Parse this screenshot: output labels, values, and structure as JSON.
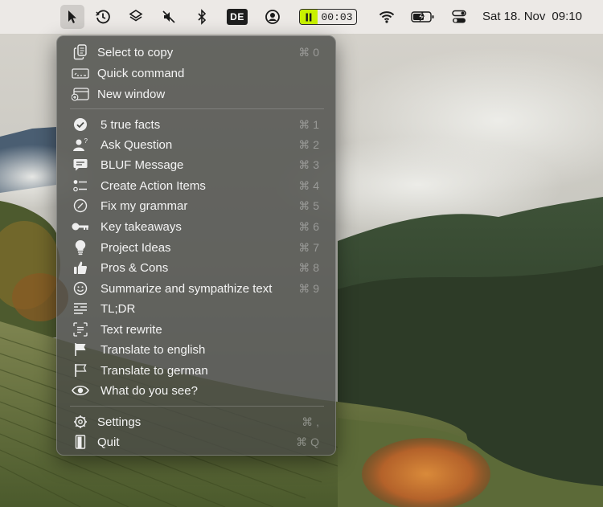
{
  "menubar": {
    "icons": [
      "cursor-icon",
      "history-icon",
      "layers-icon",
      "mute-icon",
      "bluetooth-icon",
      "keyboard-layout-badge",
      "user-account-icon",
      "pause-icon",
      "wifi-icon",
      "battery-charging-icon",
      "control-center-icon"
    ],
    "input_source": "DE",
    "timer": "00:03",
    "date": "Sat 18. Nov",
    "time": "09:10"
  },
  "menu": {
    "top_items": [
      {
        "label": "Select to copy",
        "shortcut": "⌘ 0",
        "icon": "copy-icon"
      },
      {
        "label": "Quick command",
        "shortcut": "",
        "icon": "command-prompt-icon"
      },
      {
        "label": "New window",
        "shortcut": "",
        "icon": "new-window-icon"
      }
    ],
    "prompt_items": [
      {
        "label": "5 true facts",
        "shortcut": "⌘ 1",
        "icon": "checkmark-circle-icon"
      },
      {
        "label": "Ask Question",
        "shortcut": "⌘ 2",
        "icon": "person-question-icon"
      },
      {
        "label": "BLUF Message",
        "shortcut": "⌘ 3",
        "icon": "message-bubble-icon"
      },
      {
        "label": "Create Action Items",
        "shortcut": "⌘ 4",
        "icon": "checklist-icon"
      },
      {
        "label": "Fix my grammar",
        "shortcut": "⌘ 5",
        "icon": "slash-circle-icon"
      },
      {
        "label": "Key takeaways",
        "shortcut": "⌘ 6",
        "icon": "key-icon"
      },
      {
        "label": "Project Ideas",
        "shortcut": "⌘ 7",
        "icon": "lightbulb-icon"
      },
      {
        "label": "Pros & Cons",
        "shortcut": "⌘ 8",
        "icon": "thumbs-up-icon"
      },
      {
        "label": "Summarize and sympathize text",
        "shortcut": "⌘ 9",
        "icon": "smiley-icon"
      },
      {
        "label": "TL;DR",
        "shortcut": "",
        "icon": "text-lines-icon"
      },
      {
        "label": "Text rewrite",
        "shortcut": "",
        "icon": "text-scan-icon"
      },
      {
        "label": "Translate to english",
        "shortcut": "",
        "icon": "flag-filled-icon"
      },
      {
        "label": "Translate to german",
        "shortcut": "",
        "icon": "flag-outline-icon"
      },
      {
        "label": "What do you see?",
        "shortcut": "",
        "icon": "eye-icon"
      }
    ],
    "bottom_items": [
      {
        "label": "Settings",
        "shortcut": "⌘ ,",
        "icon": "gear-icon"
      },
      {
        "label": "Quit",
        "shortcut": "⌘ Q",
        "icon": "quit-door-icon"
      }
    ]
  },
  "colors": {
    "menubar_bg": "#ece9e6",
    "menu_bg": "rgba(72,74,70,0.80)",
    "timer_accent": "#c8f000"
  }
}
